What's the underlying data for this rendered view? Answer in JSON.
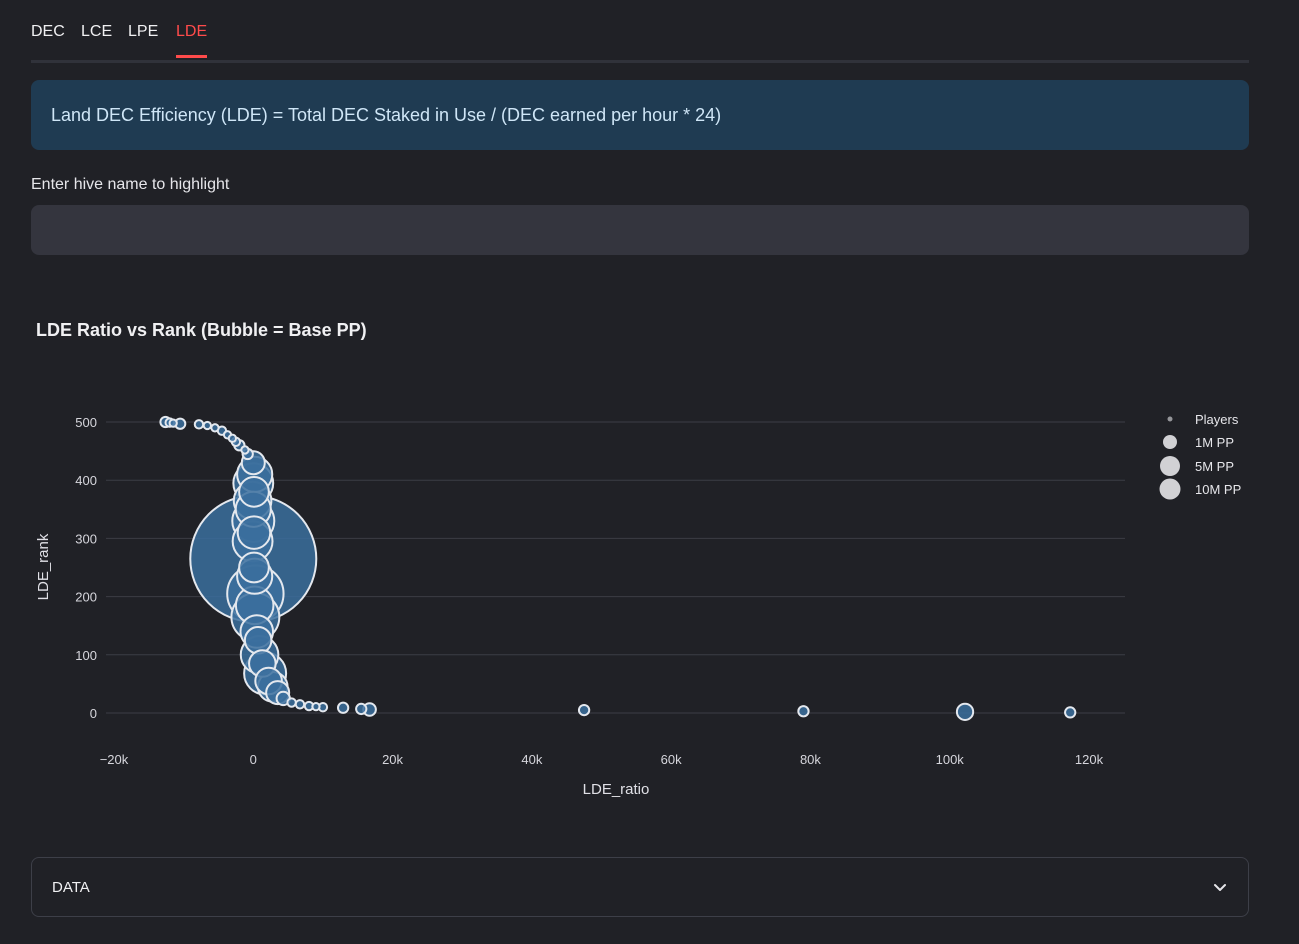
{
  "tabs": [
    {
      "label": "DEC",
      "active": false
    },
    {
      "label": "LCE",
      "active": false
    },
    {
      "label": "LPE",
      "active": false
    },
    {
      "label": "LDE",
      "active": true
    }
  ],
  "info_text": "Land DEC Efficiency (LDE) = Total DEC Staked in Use / (DEC earned per hour * 24)",
  "highlight_input": {
    "label": "Enter hive name to highlight",
    "value": "",
    "placeholder": ""
  },
  "expander": {
    "label": "DATA",
    "icon": "chevron-down-icon"
  },
  "colors": {
    "bubble_fill": "#3b6e9e",
    "bubble_stroke": "#e4e8ee",
    "accent": "#ff4b4b",
    "grid": "#3b3d45"
  },
  "chart_data": {
    "type": "scatter",
    "title": "LDE Ratio vs Rank (Bubble = Base PP)",
    "xlabel": "LDE_ratio",
    "ylabel": "LDE_rank",
    "xlim": [
      -20000,
      125000
    ],
    "ylim": [
      -10,
      520
    ],
    "xticks": [
      -20000,
      0,
      20000,
      40000,
      60000,
      80000,
      100000,
      120000
    ],
    "xtick_labels": [
      "−20k",
      "0",
      "20k",
      "40k",
      "60k",
      "80k",
      "100k",
      "120k"
    ],
    "yticks": [
      0,
      100,
      200,
      300,
      400,
      500
    ],
    "ytick_labels": [
      "0",
      "100",
      "200",
      "300",
      "400",
      "500"
    ],
    "grid": true,
    "legend_position": "top-right",
    "legend": [
      {
        "label": "Players",
        "size_pp": 20000
      },
      {
        "label": "1M PP",
        "size_pp": 1000000
      },
      {
        "label": "5M PP",
        "size_pp": 5000000
      },
      {
        "label": "10M PP",
        "size_pp": 10000000
      }
    ],
    "series": [
      {
        "points": [
          {
            "x": -12600,
            "y": 500,
            "pp": 60000
          },
          {
            "x": -12000,
            "y": 499,
            "pp": 40000
          },
          {
            "x": -11500,
            "y": 498,
            "pp": 30000
          },
          {
            "x": -10500,
            "y": 497,
            "pp": 60000
          },
          {
            "x": -7800,
            "y": 496,
            "pp": 40000
          },
          {
            "x": -6600,
            "y": 494,
            "pp": 30000
          },
          {
            "x": -5500,
            "y": 490,
            "pp": 30000
          },
          {
            "x": -4500,
            "y": 485,
            "pp": 40000
          },
          {
            "x": -3700,
            "y": 478,
            "pp": 30000
          },
          {
            "x": -3000,
            "y": 472,
            "pp": 30000
          },
          {
            "x": -2500,
            "y": 466,
            "pp": 40000
          },
          {
            "x": -2000,
            "y": 460,
            "pp": 60000
          },
          {
            "x": -1200,
            "y": 452,
            "pp": 30000
          },
          {
            "x": -800,
            "y": 445,
            "pp": 60000
          },
          {
            "x": 0,
            "y": 430,
            "pp": 300000
          },
          {
            "x": 200,
            "y": 410,
            "pp": 700000
          },
          {
            "x": 0,
            "y": 395,
            "pp": 900000
          },
          {
            "x": 100,
            "y": 380,
            "pp": 500000
          },
          {
            "x": -100,
            "y": 365,
            "pp": 800000
          },
          {
            "x": 0,
            "y": 350,
            "pp": 700000
          },
          {
            "x": 0,
            "y": 330,
            "pp": 1000000
          },
          {
            "x": 100,
            "y": 310,
            "pp": 600000
          },
          {
            "x": -100,
            "y": 295,
            "pp": 900000
          },
          {
            "x": 0,
            "y": 265,
            "pp": 9000000
          },
          {
            "x": 100,
            "y": 250,
            "pp": 500000
          },
          {
            "x": 200,
            "y": 235,
            "pp": 700000
          },
          {
            "x": 300,
            "y": 205,
            "pp": 1800000
          },
          {
            "x": 200,
            "y": 185,
            "pp": 800000
          },
          {
            "x": 300,
            "y": 165,
            "pp": 1300000
          },
          {
            "x": 500,
            "y": 140,
            "pp": 600000
          },
          {
            "x": 700,
            "y": 125,
            "pp": 400000
          },
          {
            "x": 900,
            "y": 100,
            "pp": 800000
          },
          {
            "x": 1300,
            "y": 85,
            "pp": 400000
          },
          {
            "x": 1700,
            "y": 68,
            "pp": 1000000
          },
          {
            "x": 2200,
            "y": 55,
            "pp": 400000
          },
          {
            "x": 2800,
            "y": 45,
            "pp": 500000
          },
          {
            "x": 3500,
            "y": 35,
            "pp": 300000
          },
          {
            "x": 4300,
            "y": 25,
            "pp": 100000
          },
          {
            "x": 5500,
            "y": 18,
            "pp": 40000
          },
          {
            "x": 6700,
            "y": 15,
            "pp": 40000
          },
          {
            "x": 8000,
            "y": 12,
            "pp": 40000
          },
          {
            "x": 9000,
            "y": 11,
            "pp": 30000
          },
          {
            "x": 10000,
            "y": 10,
            "pp": 40000
          },
          {
            "x": 12900,
            "y": 9,
            "pp": 60000
          },
          {
            "x": 15500,
            "y": 7,
            "pp": 60000
          },
          {
            "x": 16700,
            "y": 6,
            "pp": 90000
          },
          {
            "x": 47500,
            "y": 5,
            "pp": 60000
          },
          {
            "x": 79000,
            "y": 3,
            "pp": 60000
          },
          {
            "x": 102200,
            "y": 2,
            "pp": 150000
          },
          {
            "x": 117300,
            "y": 1,
            "pp": 60000
          }
        ]
      }
    ]
  }
}
